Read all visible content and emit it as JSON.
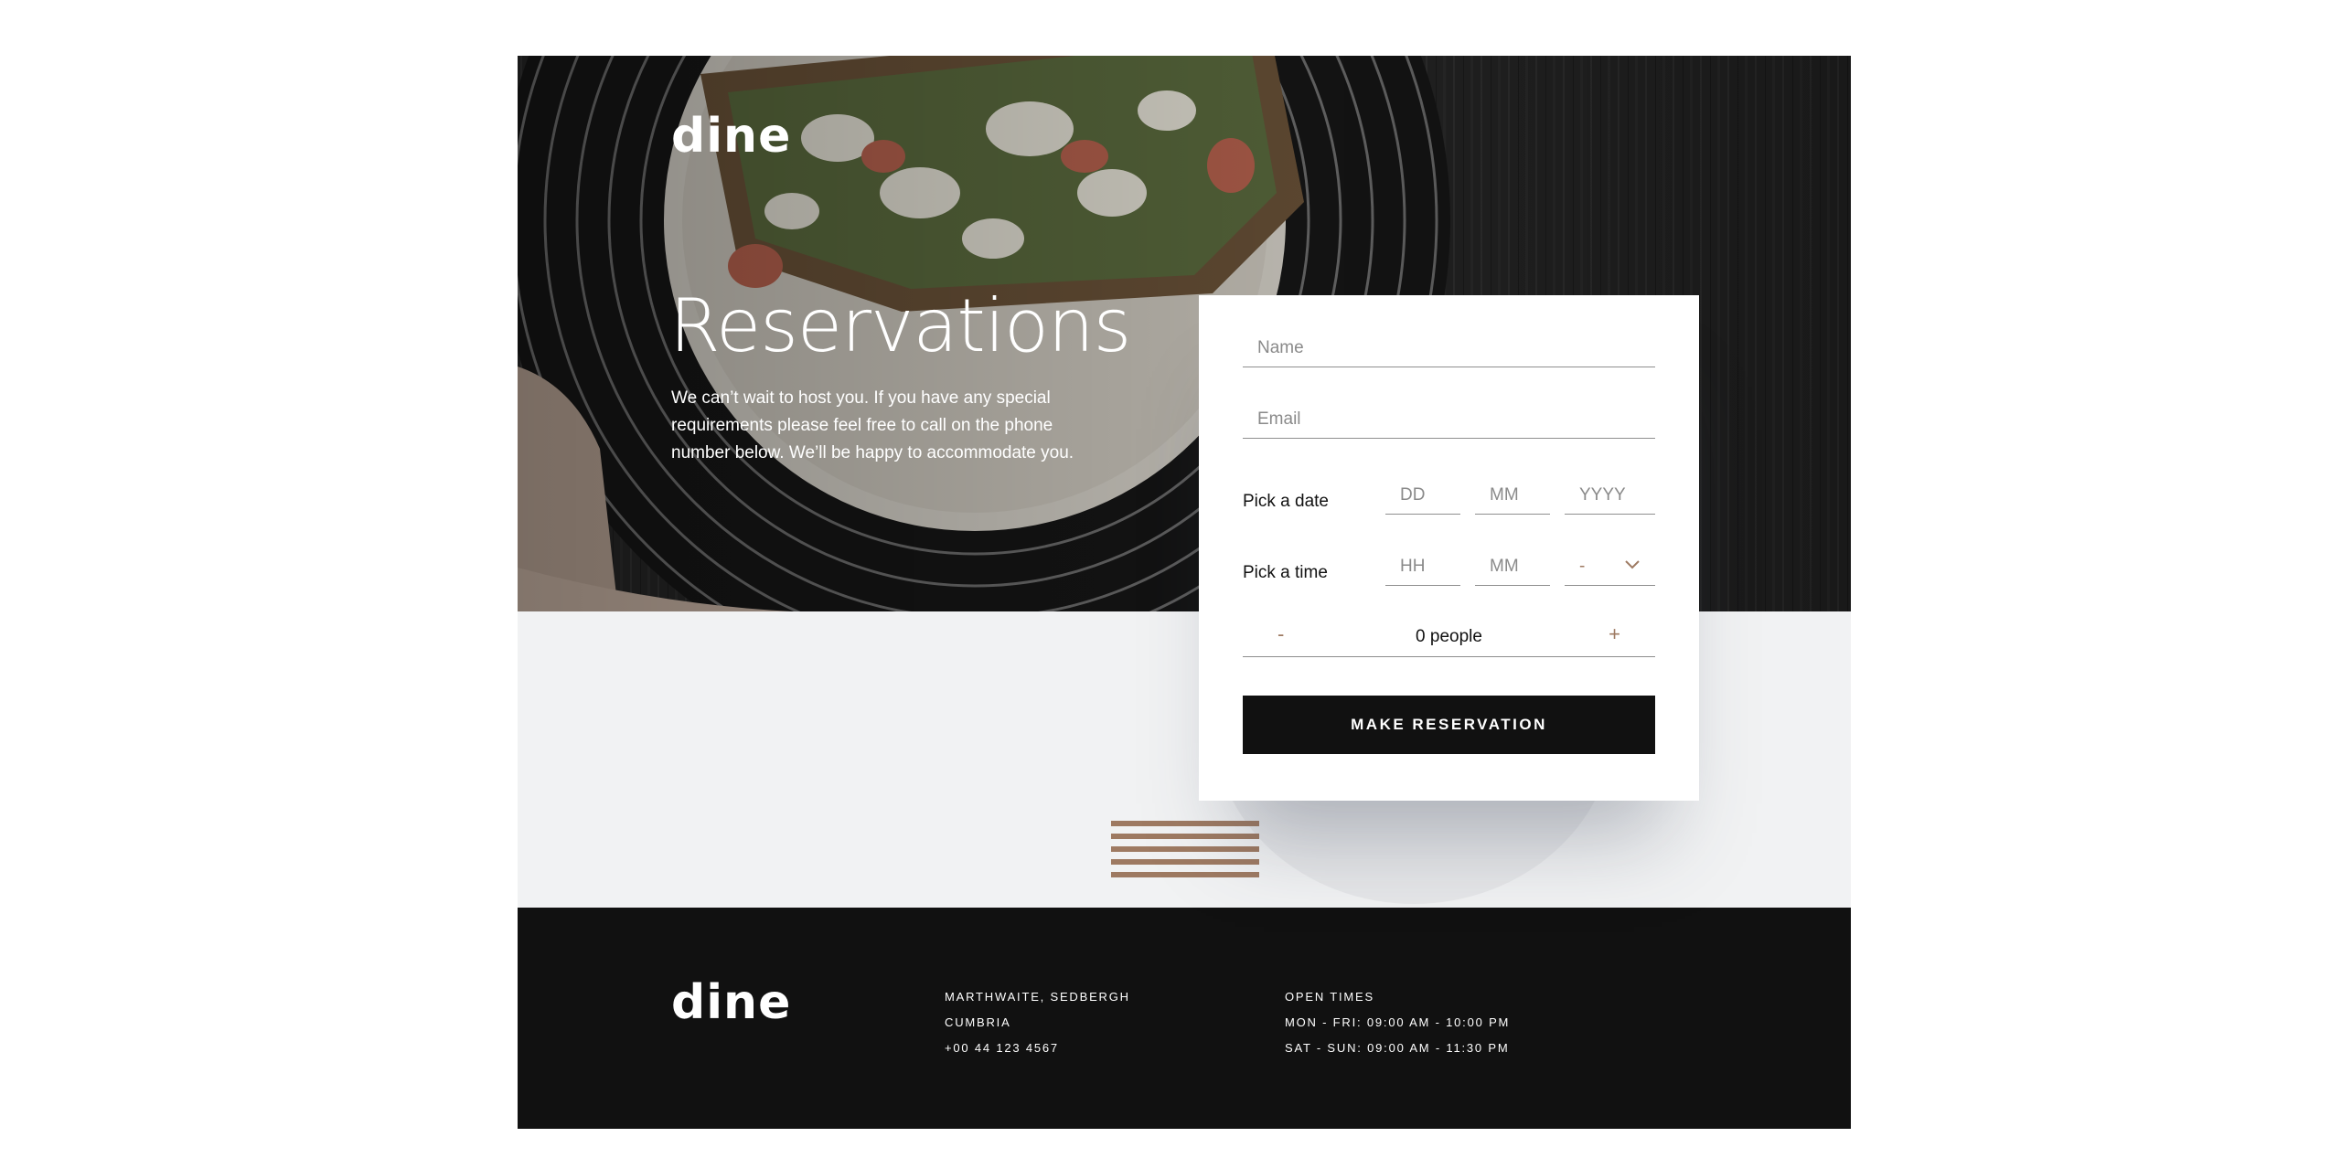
{
  "brand": {
    "logo": "dine"
  },
  "hero": {
    "title": "Reservations",
    "text": "We can’t wait to host you. If you have any special requirements please feel free to call on the phone number below. We’ll be happy to accommodate you."
  },
  "form": {
    "name_placeholder": "Name",
    "email_placeholder": "Email",
    "date_label": "Pick a date",
    "date_day_placeholder": "DD",
    "date_month_placeholder": "MM",
    "date_year_placeholder": "YYYY",
    "time_label": "Pick a time",
    "time_hour_placeholder": "HH",
    "time_minute_placeholder": "MM",
    "ampm_value": "-",
    "people_minus": "-",
    "people_count": "0 people",
    "people_plus": "+",
    "submit_label": "MAKE RESERVATION"
  },
  "footer": {
    "logo": "dine",
    "address": [
      "MARTHWAITE, SEDBERGH",
      "CUMBRIA",
      "+00 44 123 4567"
    ],
    "hours": [
      "OPEN TIMES",
      "MON - FRI: 09:00 AM - 10:00 PM",
      "SAT - SUN: 09:00 AM - 11:30 PM"
    ]
  },
  "colors": {
    "accent": "#9e7a62",
    "dark": "#111111",
    "light_gray": "#f1f2f3"
  }
}
